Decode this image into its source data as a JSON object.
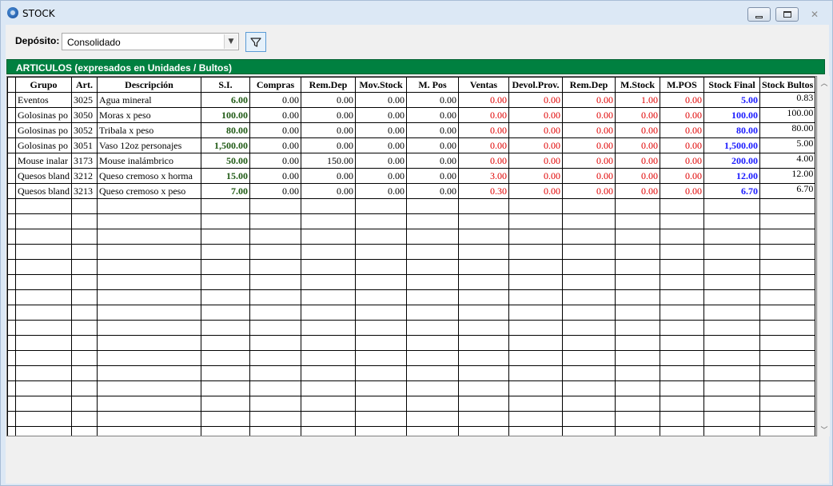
{
  "window": {
    "title": "STOCK"
  },
  "toolbar": {
    "deposito_label": "Depósito:",
    "deposito_value": "Consolidado"
  },
  "section": {
    "title": "ARTICULOS (expresados en Unidades / Bultos)"
  },
  "table": {
    "columns": [
      "Grupo",
      "Art.",
      "Descripción",
      "S.I.",
      "Compras",
      "Rem.Dep",
      "Mov.Stock",
      "M. Pos",
      "Ventas",
      "Devol.Prov.",
      "Rem.Dep",
      "M.Stock",
      "M.POS",
      "Stock Final",
      "Stock Bultos"
    ],
    "rows": [
      [
        "Eventos",
        "3025",
        "Agua mineral",
        "6.00",
        "0.00",
        "0.00",
        "0.00",
        "0.00",
        "0.00",
        "0.00",
        "0.00",
        "1.00",
        "0.00",
        "5.00",
        "0.83"
      ],
      [
        "Golosinas po",
        "3050",
        "Moras x peso",
        "100.00",
        "0.00",
        "0.00",
        "0.00",
        "0.00",
        "0.00",
        "0.00",
        "0.00",
        "0.00",
        "0.00",
        "100.00",
        "100.00"
      ],
      [
        "Golosinas po",
        "3052",
        "Tribala x peso",
        "80.00",
        "0.00",
        "0.00",
        "0.00",
        "0.00",
        "0.00",
        "0.00",
        "0.00",
        "0.00",
        "0.00",
        "80.00",
        "80.00"
      ],
      [
        "Golosinas po",
        "3051",
        "Vaso 12oz personajes",
        "1,500.00",
        "0.00",
        "0.00",
        "0.00",
        "0.00",
        "0.00",
        "0.00",
        "0.00",
        "0.00",
        "0.00",
        "1,500.00",
        "5.00"
      ],
      [
        "Mouse inalar",
        "3173",
        "Mouse inalámbrico",
        "50.00",
        "0.00",
        "150.00",
        "0.00",
        "0.00",
        "0.00",
        "0.00",
        "0.00",
        "0.00",
        "0.00",
        "200.00",
        "4.00"
      ],
      [
        "Quesos bland",
        "3212",
        "Queso cremoso x horma",
        "15.00",
        "0.00",
        "0.00",
        "0.00",
        "0.00",
        "3.00",
        "0.00",
        "0.00",
        "0.00",
        "0.00",
        "12.00",
        "12.00"
      ],
      [
        "Quesos bland",
        "3213",
        "Queso cremoso x peso",
        "7.00",
        "0.00",
        "0.00",
        "0.00",
        "0.00",
        "0.30",
        "0.00",
        "0.00",
        "0.00",
        "0.00",
        "6.70",
        "6.70"
      ]
    ],
    "empty_rows": 16
  },
  "colors": {
    "section_bar": "#008040",
    "si": "#1f5a14",
    "negative_cols": "#e00000",
    "stock_final": "#1a1aff"
  }
}
